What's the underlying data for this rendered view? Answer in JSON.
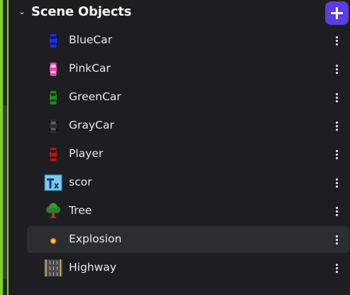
{
  "panel": {
    "title": "Scene Objects",
    "add_button_icon": "plus-icon",
    "accent_color": "#7ed321",
    "button_color": "#5b3de0"
  },
  "objects": [
    {
      "label": "BlueCar",
      "icon": "blue-car-icon",
      "color": "#1a2fe0"
    },
    {
      "label": "PinkCar",
      "icon": "pink-car-icon",
      "color": "#e64ca8"
    },
    {
      "label": "GreenCar",
      "icon": "green-car-icon",
      "color": "#1e8a2a"
    },
    {
      "label": "GrayCar",
      "icon": "gray-car-icon",
      "color": "#2b2b2b"
    },
    {
      "label": "Player",
      "icon": "red-car-icon",
      "color": "#b31818"
    },
    {
      "label": "scor",
      "icon": "text-object-icon"
    },
    {
      "label": "Tree",
      "icon": "tree-icon"
    },
    {
      "label": "Explosion",
      "icon": "explosion-icon",
      "selected": true
    },
    {
      "label": "Highway",
      "icon": "road-icon"
    }
  ]
}
